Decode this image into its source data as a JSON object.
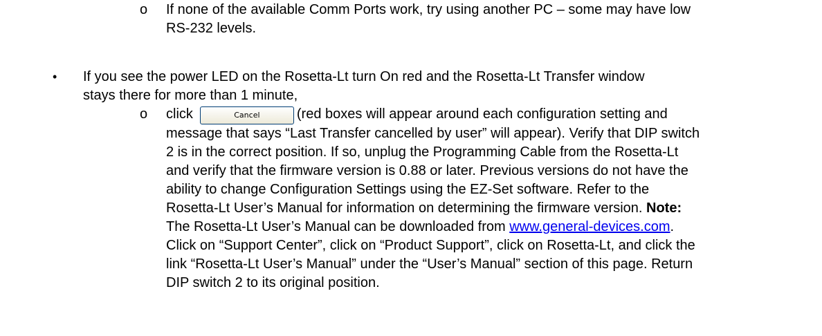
{
  "item1": {
    "bullet": "o",
    "line1": "If none of the available Comm Ports work, try using another PC – some may have low",
    "line2": "RS-232 levels."
  },
  "item2": {
    "bullet": "•",
    "line1": "If you see the power LED on the Rosetta-Lt turn On red and the Rosetta-Lt Transfer window",
    "line2": "stays there for more than 1 minute,"
  },
  "item3": {
    "bullet": "o",
    "click_word": "click",
    "cancel_button_label": "Cancel",
    "line1_rest": "(red boxes will appear around each configuration setting and",
    "line2": "message that says “Last Transfer cancelled by user” will appear).  Verify that DIP switch",
    "line3": "2 is in the correct position.  If so, unplug the Programming Cable from the Rosetta-Lt",
    "line4": "and verify that the firmware version is 0.88 or later.  Previous versions do not have the",
    "line5": "ability to change Configuration Settings using the EZ-Set software.  Refer to the",
    "line6_pre": "Rosetta-Lt User’s Manual for information on determining the firmware version.  ",
    "note_label": "Note:",
    "line7_pre": "The Rosetta-Lt User’s Manual can be downloaded from ",
    "link_text": "www.general-devices.com",
    "line7_post": ".",
    "line8": "Click on “Support Center”, click on “Product Support”, click on Rosetta-Lt, and click the",
    "line9": "link “Rosetta-Lt User’s Manual” under the “User’s Manual” section of this page.  Return",
    "line10": "DIP switch 2 to its original position."
  }
}
